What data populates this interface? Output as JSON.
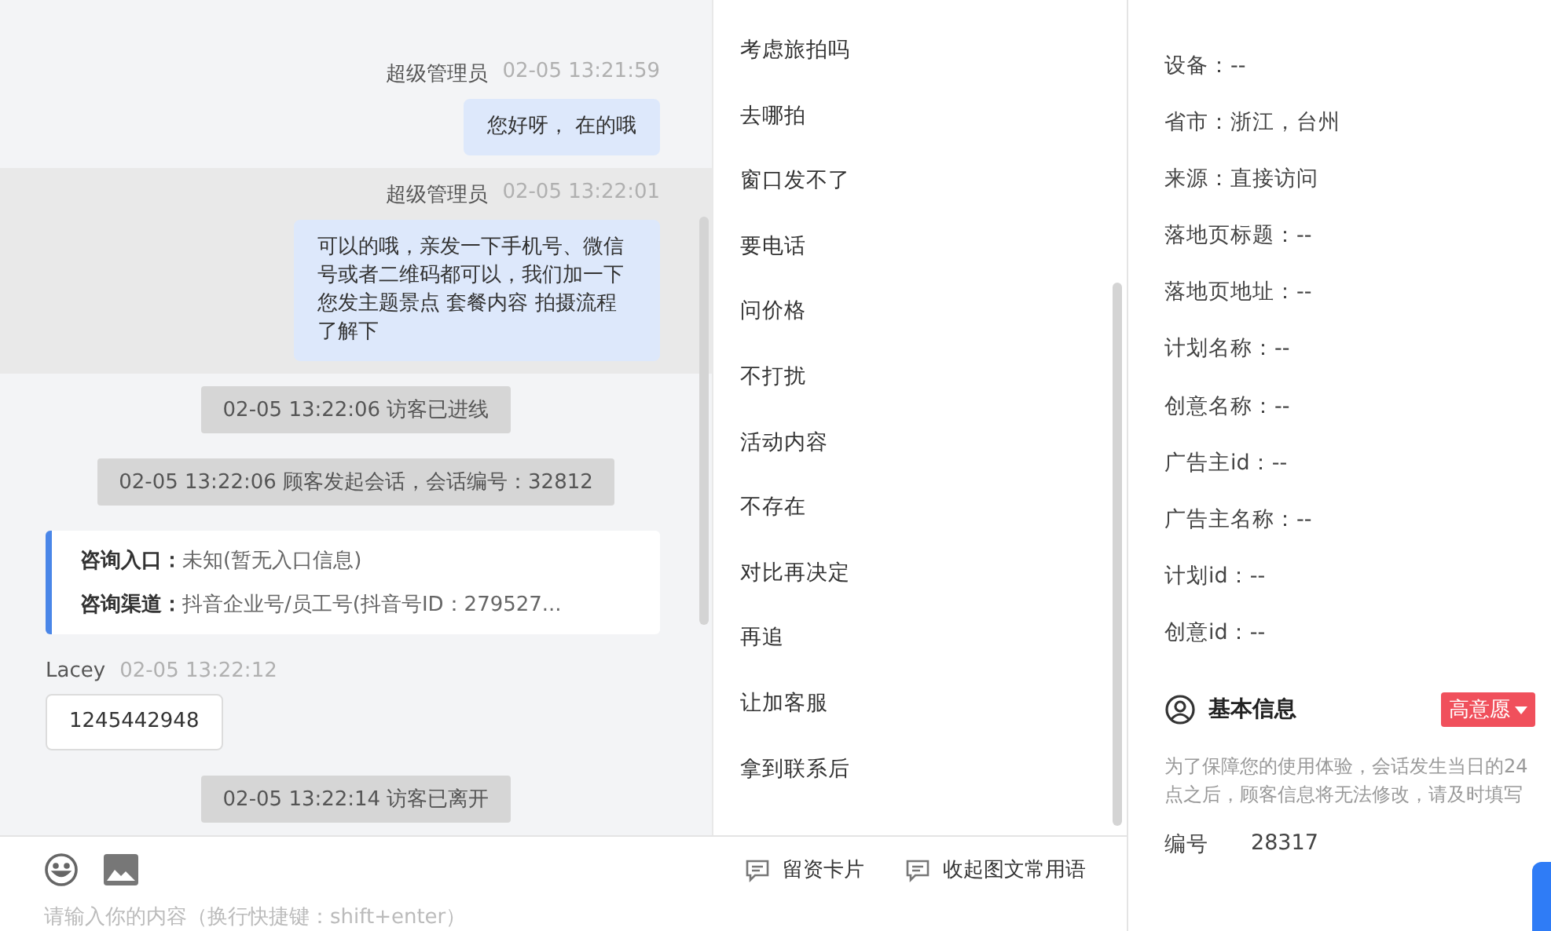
{
  "chat": {
    "messages": [
      {
        "kind": "agent",
        "sender": "超级管理员",
        "time": "02-05 13:21:59",
        "text": "您好呀， 在的哦",
        "highlighted": false
      },
      {
        "kind": "agent",
        "sender": "超级管理员",
        "time": "02-05 13:22:01",
        "text": "可以的哦，亲发一下手机号、微信号或者二维码都可以，我们加一下您发主题景点 套餐内容 拍摄流程了解下",
        "highlighted": true
      },
      {
        "kind": "system",
        "text": "02-05 13:22:06 访客已进线"
      },
      {
        "kind": "system",
        "text": "02-05 13:22:06 顾客发起会话，会话编号：32812"
      },
      {
        "kind": "info",
        "rows": [
          {
            "label": "咨询入口：",
            "value": "未知(暂无入口信息)"
          },
          {
            "label": "咨询渠道：",
            "value": "抖音企业号/员工号(抖音号ID：279527..."
          }
        ]
      },
      {
        "kind": "visitor",
        "sender": "Lacey",
        "time": "02-05 13:22:12",
        "text": "1245442948",
        "highlighted": false
      },
      {
        "kind": "system",
        "text": "02-05 13:22:14 访客已离开"
      }
    ]
  },
  "composer": {
    "placeholder": "请输入你的内容（换行快捷键：shift+enter）",
    "actions": [
      "留资卡片",
      "收起图文常用语"
    ]
  },
  "quick_replies": [
    "考虑旅拍吗",
    "去哪拍",
    "窗口发不了",
    "要电话",
    "问价格",
    "不打扰",
    "活动内容",
    "不存在",
    "对比再决定",
    "再追",
    "让加客服",
    "拿到联系后"
  ],
  "source_info": {
    "fields": [
      "设备：--",
      "省市：浙江，台州",
      "来源：直接访问",
      "落地页标题：--",
      "落地页地址：--",
      "计划名称：--",
      "创意名称：--",
      "广告主id：--",
      "广告主名称：--",
      "计划id：--",
      "创意id：--"
    ]
  },
  "basic_info": {
    "title": "基本信息",
    "intent_tag": "高意愿",
    "notice": "为了保障您的使用体验，会话发生当日的24点之后，顾客信息将无法修改，请及时填写",
    "fields": [
      {
        "label": "编号",
        "value": "28317"
      }
    ]
  }
}
